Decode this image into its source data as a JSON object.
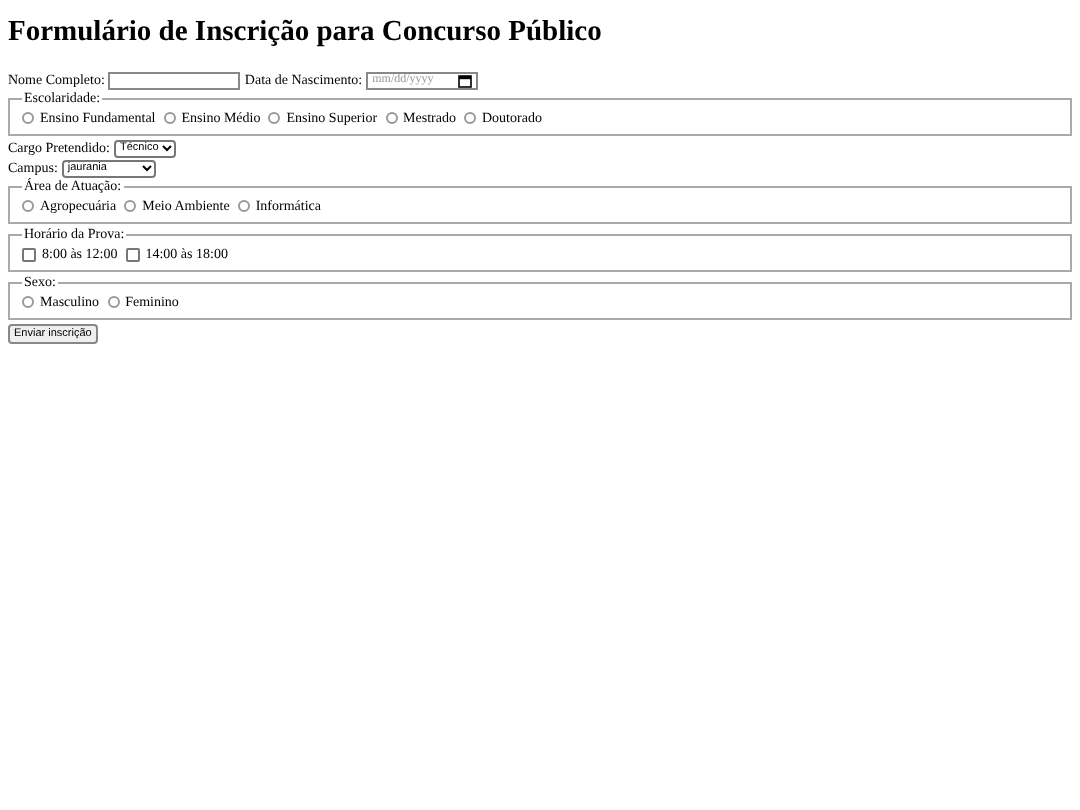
{
  "title": "Formulário de Inscrição para Concurso Público",
  "nome": {
    "label": "Nome Completo:"
  },
  "nascimento": {
    "label": "Data de Nascimento:",
    "placeholder": "mm/dd/yyyy"
  },
  "escolaridade": {
    "legend": "Escolaridade:",
    "kind": "radio",
    "options": [
      {
        "label": "Ensino Fundamental",
        "selected": false
      },
      {
        "label": "Ensino Médio",
        "selected": false
      },
      {
        "label": "Ensino Superior",
        "selected": false
      },
      {
        "label": "Mestrado",
        "selected": false
      },
      {
        "label": "Doutorado",
        "selected": false
      }
    ]
  },
  "cargo": {
    "label": "Cargo Pretendido:",
    "value": "Técnico"
  },
  "campus": {
    "label": "Campus:",
    "value": "jaurania"
  },
  "area": {
    "legend": "Área de Atuação:",
    "kind": "radio",
    "options": [
      {
        "label": "Agropecuária",
        "selected": false
      },
      {
        "label": "Meio Ambiente",
        "selected": false
      },
      {
        "label": "Informática",
        "selected": false
      }
    ]
  },
  "horario": {
    "legend": "Horário da Prova:",
    "kind": "checkbox",
    "options": [
      {
        "label": "8:00 às 12:00",
        "checked": false
      },
      {
        "label": "14:00 às 18:00",
        "checked": false
      }
    ]
  },
  "sexo": {
    "legend": "Sexo:",
    "kind": "radio",
    "options": [
      {
        "label": "Masculino",
        "selected": false
      },
      {
        "label": "Feminino",
        "selected": false
      }
    ]
  },
  "submit": "Enviar inscrição"
}
